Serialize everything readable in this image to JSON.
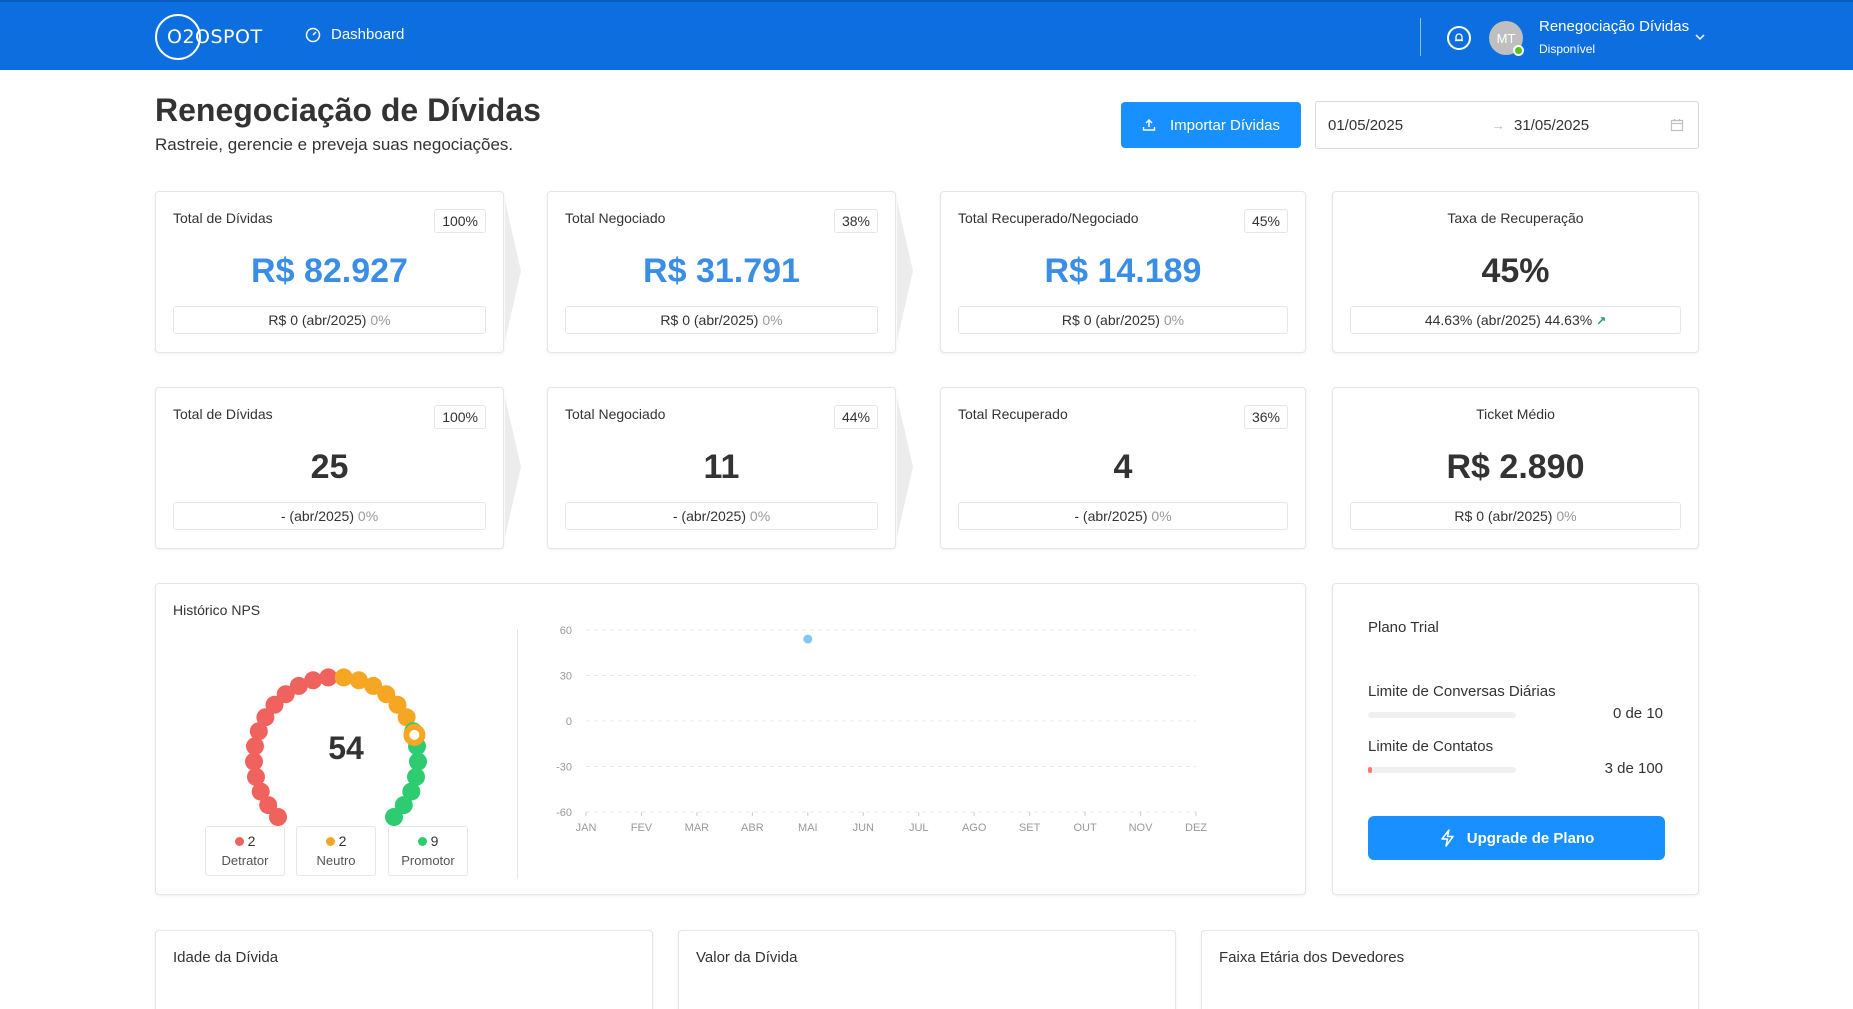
{
  "topbar": {
    "logo_text": "O2OSPOT",
    "nav_dashboard": "Dashboard",
    "avatar_initials": "MT",
    "user_name": "Renegociação Dívidas",
    "user_status": "Disponível"
  },
  "header": {
    "title": "Renegociação de Dívidas",
    "subtitle": "Rastreie, gerencie e preveja suas negociações.",
    "import_button": "Importar Dívidas",
    "date_from": "01/05/2025",
    "date_to": "31/05/2025"
  },
  "stats_row1": [
    {
      "label": "Total de Dívidas",
      "pct": "100%",
      "value": "R$ 82.927",
      "foot_main": "R$ 0 (abr/2025)",
      "foot_delta": "0%"
    },
    {
      "label": "Total Negociado",
      "pct": "38%",
      "value": "R$ 31.791",
      "foot_main": "R$ 0 (abr/2025)",
      "foot_delta": "0%"
    },
    {
      "label": "Total Recuperado/Negociado",
      "pct": "45%",
      "value": "R$ 14.189",
      "foot_main": "R$ 0 (abr/2025)",
      "foot_delta": "0%"
    },
    {
      "label": "Taxa de Recuperação",
      "value": "45%",
      "foot_main": "44.63% (abr/2025)",
      "foot_delta": "44.63%",
      "foot_arrow": "↗"
    }
  ],
  "stats_row2": [
    {
      "label": "Total de Dívidas",
      "pct": "100%",
      "value": "25",
      "foot_main": "- (abr/2025)",
      "foot_delta": "0%"
    },
    {
      "label": "Total Negociado",
      "pct": "44%",
      "value": "11",
      "foot_main": "- (abr/2025)",
      "foot_delta": "0%"
    },
    {
      "label": "Total Recuperado",
      "pct": "36%",
      "value": "4",
      "foot_main": "- (abr/2025)",
      "foot_delta": "0%"
    },
    {
      "label": "Ticket Médio",
      "value": "R$ 2.890",
      "foot_main": "R$ 0 (abr/2025)",
      "foot_delta": "0%"
    }
  ],
  "nps": {
    "title": "Histórico NPS",
    "score": "54",
    "legend": [
      {
        "count": "2",
        "name": "Detrator",
        "color": "#f0625d"
      },
      {
        "count": "2",
        "name": "Neutro",
        "color": "#f5a623"
      },
      {
        "count": "9",
        "name": "Promotor",
        "color": "#2ecc71"
      }
    ],
    "colors": {
      "detractor": "#f0625d",
      "neutral": "#f5a623",
      "promoter": "#2ecc71",
      "point": "#85c6f5"
    }
  },
  "chart_data": {
    "type": "scatter",
    "categories": [
      "JAN",
      "FEV",
      "MAR",
      "ABR",
      "MAI",
      "JUN",
      "JUL",
      "AGO",
      "SET",
      "OUT",
      "NOV",
      "DEZ"
    ],
    "y_ticks": [
      "60",
      "30",
      "0",
      "-30",
      "-60"
    ],
    "ylim": [
      -60,
      60
    ],
    "grid": true,
    "points": [
      {
        "x": "MAI",
        "y": 54
      }
    ]
  },
  "plan": {
    "title": "Plano Trial",
    "conversations_label": "Limite de Conversas Diárias",
    "conversations_value": "0 de 10",
    "conversations_fraction": 0,
    "contacts_label": "Limite de Contatos",
    "contacts_value": "3 de 100",
    "contacts_fraction": 0.03,
    "upgrade_button": "Upgrade de Plano"
  },
  "bottom": {
    "age_title": "Idade da Dívida",
    "value_title": "Valor da Dívida",
    "age_range_title": "Faixa Etária dos Devedores"
  }
}
